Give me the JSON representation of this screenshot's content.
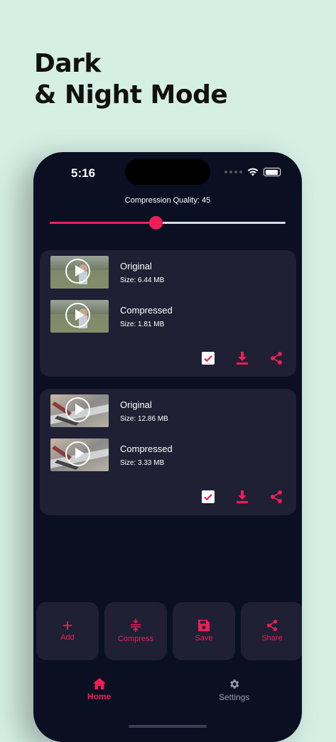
{
  "promo": {
    "line1": "Dark",
    "line2": "& Night Mode"
  },
  "status_bar": {
    "time": "5:16"
  },
  "compression": {
    "label": "Compression Quality: 45",
    "quality": 45,
    "max": 100
  },
  "videos": [
    {
      "original": {
        "title": "Original",
        "size": "Size: 6.44 MB"
      },
      "compressed": {
        "title": "Compressed",
        "size": "Size: 1.81 MB"
      },
      "selected": true
    },
    {
      "original": {
        "title": "Original",
        "size": "Size: 12.86 MB"
      },
      "compressed": {
        "title": "Compressed",
        "size": "Size: 3.33 MB"
      },
      "selected": true
    }
  ],
  "actions": [
    {
      "label": "Add",
      "icon": "plus-icon"
    },
    {
      "label": "Compress",
      "icon": "compress-icon"
    },
    {
      "label": "Save",
      "icon": "save-icon"
    },
    {
      "label": "Share",
      "icon": "share-icon"
    }
  ],
  "nav": [
    {
      "label": "Home",
      "icon": "home-icon",
      "active": true
    },
    {
      "label": "Settings",
      "icon": "gear-icon",
      "active": false
    }
  ],
  "colors": {
    "accent": "#ee1e57",
    "background": "#0b0f22",
    "card": "#1f2033",
    "inactive": "#9a9cab"
  }
}
